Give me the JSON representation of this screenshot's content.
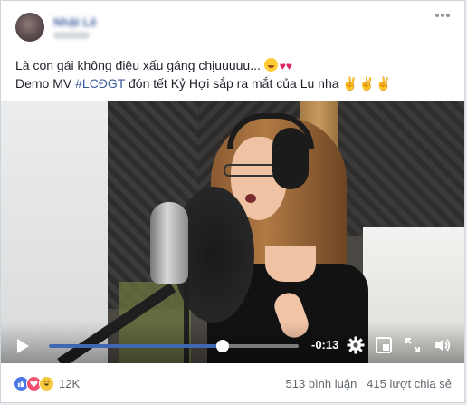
{
  "post": {
    "author_name": "Nhật Lê",
    "caption_line1": "Là con gái không điệu xấu gáng chịuuuuu...",
    "caption_line1_emoji": [
      "grinning-face-emoji",
      "two-hearts-emoji"
    ],
    "caption_line2_prefix": "Demo MV ",
    "hashtag": "#LCĐGT",
    "caption_line2_suffix": " đón tết Kỷ Hợi sắp ra mắt của Lu nha",
    "caption_line2_emoji": [
      "victory-hand-emoji",
      "victory-hand-emoji",
      "victory-hand-emoji"
    ]
  },
  "video": {
    "time_remaining": "-0:13",
    "progress_fraction": 0.695,
    "accent_color": "#4267b2"
  },
  "footer": {
    "reaction_count": "12K",
    "comments": "513 bình luận",
    "shares": "415 lượt chia sẻ"
  }
}
